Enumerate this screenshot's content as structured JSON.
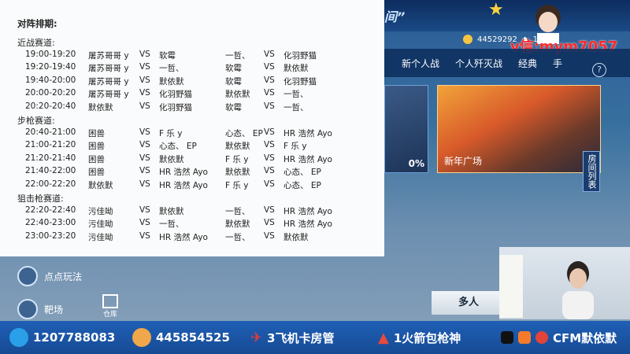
{
  "schedule": {
    "title": "对阵排期:",
    "sections": [
      {
        "name": "近战赛道:",
        "rows": [
          {
            "time": "19:00-19:20",
            "a1": "屠苏哥哥 y",
            "vs1": "VS",
            "b1": "软霉",
            "a2": "一哲、",
            "vs2": "VS",
            "b2": "化羽野猫"
          },
          {
            "time": "19:20-19:40",
            "a1": "屠苏哥哥 y",
            "vs1": "VS",
            "b1": "一哲、",
            "a2": "软霉",
            "vs2": "VS",
            "b2": "默依默"
          },
          {
            "time": "19:40-20:00",
            "a1": "屠苏哥哥 y",
            "vs1": "VS",
            "b1": "默依默",
            "a2": "软霉",
            "vs2": "VS",
            "b2": "化羽野猫"
          },
          {
            "time": "20:00-20:20",
            "a1": "屠苏哥哥 y",
            "vs1": "VS",
            "b1": "化羽野猫",
            "a2": "默依默",
            "vs2": "VS",
            "b2": "一哲、"
          },
          {
            "time": "20:20-20:40",
            "a1": "默依默",
            "vs1": "VS",
            "b1": "化羽野猫",
            "a2": "软霉",
            "vs2": "VS",
            "b2": "一哲、"
          }
        ]
      },
      {
        "name": "步枪赛道:",
        "rows": [
          {
            "time": "20:40-21:00",
            "a1": "困兽",
            "vs1": "VS",
            "b1": "F 乐 y",
            "a2": "心态、 EP",
            "vs2": "VS",
            "b2": "HR 浩然 Ayo"
          },
          {
            "time": "21:00-21:20",
            "a1": "困兽",
            "vs1": "VS",
            "b1": "心态、 EP",
            "a2": "默依默",
            "vs2": "VS",
            "b2": "F 乐 y"
          },
          {
            "time": "21:20-21:40",
            "a1": "困兽",
            "vs1": "VS",
            "b1": "默依默",
            "a2": "F 乐 y",
            "vs2": "VS",
            "b2": "HR 浩然 Ayo"
          },
          {
            "time": "21:40-22:00",
            "a1": "困兽",
            "vs1": "VS",
            "b1": "HR 浩然 Ayo",
            "a2": "默依默",
            "vs2": "VS",
            "b2": "心态、 EP"
          },
          {
            "time": "22:00-22:20",
            "a1": "默依默",
            "vs1": "VS",
            "b1": "HR 浩然 Ayo",
            "a2": "F 乐 y",
            "vs2": "VS",
            "b2": "心态、 EP"
          }
        ]
      },
      {
        "name": "狙击枪赛道:",
        "rows": [
          {
            "time": "22:20-22:40",
            "a1": "污佳呦",
            "vs1": "VS",
            "b1": "默依默",
            "a2": "一哲、",
            "vs2": "VS",
            "b2": "HR 浩然 Ayo"
          },
          {
            "time": "22:40-23:00",
            "a1": "污佳呦",
            "vs1": "VS",
            "b1": "一哲、",
            "a2": "默依默",
            "vs2": "VS",
            "b2": "HR 浩然 Ayo"
          },
          {
            "time": "23:00-23:20",
            "a1": "污佳呦",
            "vs1": "VS",
            "b1": "HR 浩然 Ayo",
            "a2": "一哲、",
            "vs2": "VS",
            "b2": "默依默"
          }
        ]
      }
    ]
  },
  "game": {
    "title_deco": "间”",
    "currency": "44529292",
    "currency2": "1349",
    "watermark": "v信:mym7057",
    "tabs": [
      "新个人战",
      "个人歼灭战",
      "经典",
      "手"
    ],
    "help": "?",
    "map1_percent": "0%",
    "map2_name": "新年广场",
    "room_list": "房间列表",
    "side_buttons": [
      "点点玩法",
      "靶场"
    ],
    "warehouse": "仓库",
    "multiplayer": "多人"
  },
  "bottom_bar": {
    "items": [
      {
        "icon": "qq-icon",
        "text": "1207788083",
        "color": "#2aa0e8"
      },
      {
        "icon": "group-icon",
        "text": "445854525",
        "color": "#f0a64a"
      },
      {
        "icon": "plane-icon",
        "text": "3飞机卡房管",
        "color": "#e23b3b"
      },
      {
        "icon": "rocket-icon",
        "text": "1火箭包枪神",
        "color": "#e64a3a"
      },
      {
        "icon": "social-icon",
        "text": "CFM默依默",
        "color": "#111111"
      }
    ]
  },
  "colors": {
    "bottom_bar_bg": "#1f5fb6",
    "panel_bg": "#fafbfc",
    "watermark": "#ff2a2a"
  }
}
